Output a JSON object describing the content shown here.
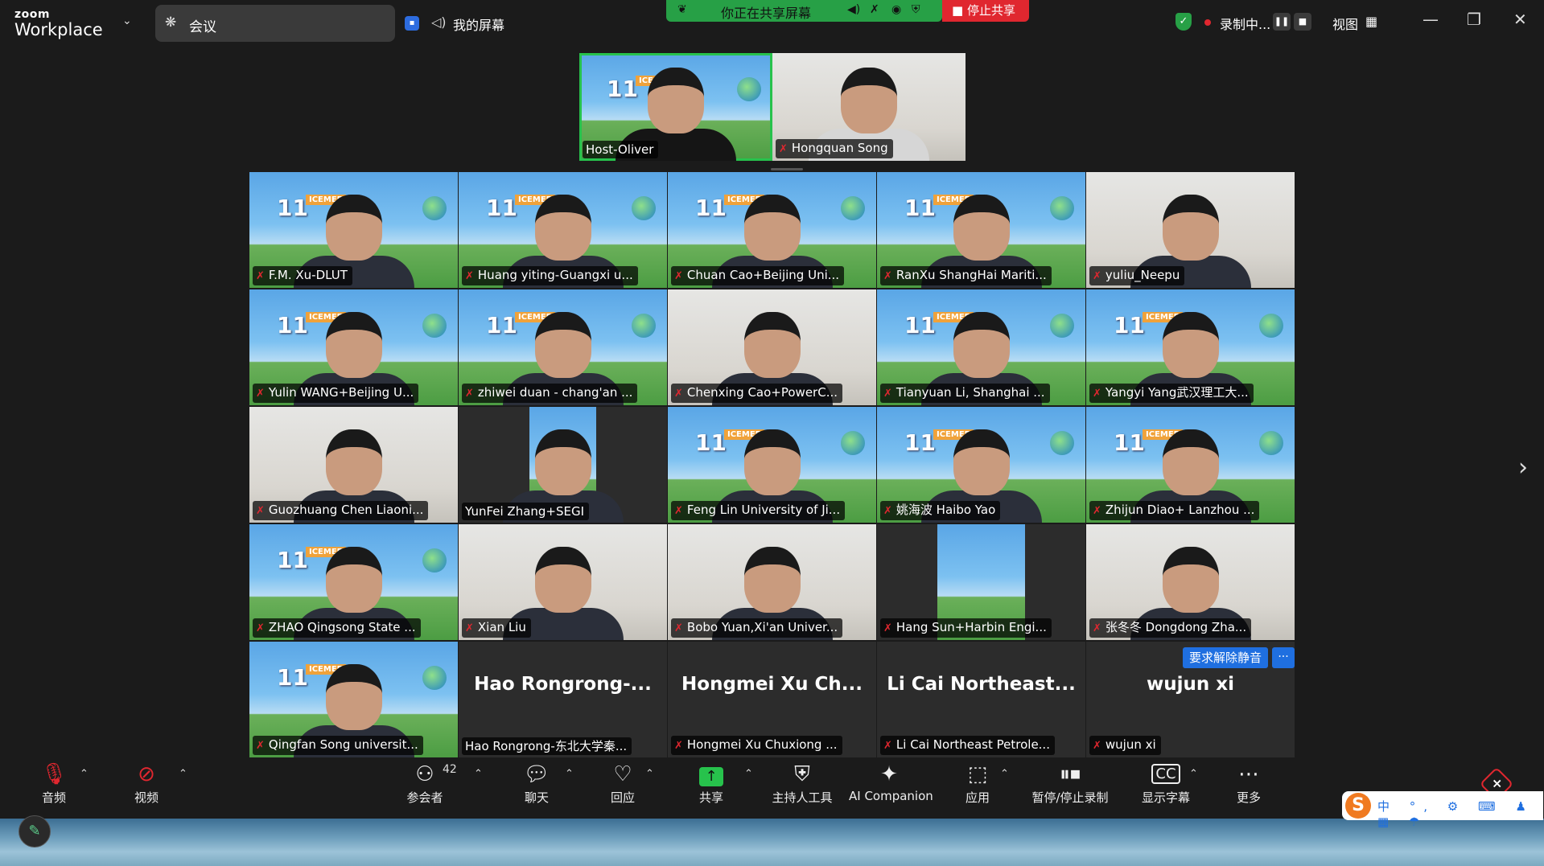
{
  "app": {
    "logo_top": "zoom",
    "logo_bottom": "Workplace"
  },
  "meeting": {
    "label": "会议"
  },
  "screen": {
    "label": "我的屏幕"
  },
  "share_bar": {
    "status": "你正在共享屏幕",
    "stop_label": "停止共享"
  },
  "recording": {
    "label": "录制中..."
  },
  "view": {
    "label": "视图"
  },
  "spotlight": [
    {
      "name": "Host-Oliver",
      "muted": false
    },
    {
      "name": "Hongquan Song",
      "muted": true
    }
  ],
  "grid": [
    {
      "name": "F.M. Xu-DLUT",
      "muted": true,
      "bg": "banner"
    },
    {
      "name": "Huang yiting-Guangxi u...",
      "muted": true,
      "bg": "banner"
    },
    {
      "name": "Chuan Cao+Beijing Uni...",
      "muted": true,
      "bg": "banner"
    },
    {
      "name": "RanXu ShangHai Mariti...",
      "muted": true,
      "bg": "banner"
    },
    {
      "name": "yuliu_Neepu",
      "muted": true,
      "bg": "room"
    },
    {
      "name": "Yulin WANG+Beijing U...",
      "muted": true,
      "bg": "banner"
    },
    {
      "name": "zhiwei duan - chang'an ...",
      "muted": true,
      "bg": "banner"
    },
    {
      "name": "Chenxing Cao+PowerC...",
      "muted": true,
      "bg": "room"
    },
    {
      "name": "Tianyuan Li, Shanghai ...",
      "muted": true,
      "bg": "banner"
    },
    {
      "name": "Yangyi Yang武汉理工大...",
      "muted": true,
      "bg": "banner"
    },
    {
      "name": "Guozhuang Chen Liaoni...",
      "muted": true,
      "bg": "room"
    },
    {
      "name": "YunFei Zhang+SEGI",
      "muted": false,
      "bg": "narrow"
    },
    {
      "name": "Feng Lin University of Ji...",
      "muted": true,
      "bg": "banner"
    },
    {
      "name": "姚海波  Haibo Yao",
      "muted": true,
      "bg": "banner"
    },
    {
      "name": "Zhijun Diao+ Lanzhou ...",
      "muted": true,
      "bg": "banner"
    },
    {
      "name": "ZHAO Qingsong  State ...",
      "muted": true,
      "bg": "banner"
    },
    {
      "name": "Xian Liu",
      "muted": true,
      "bg": "room"
    },
    {
      "name": "Bobo Yuan,Xi'an Univer...",
      "muted": true,
      "bg": "room"
    },
    {
      "name": "Hang Sun+Harbin Engi...",
      "muted": true,
      "bg": "poster"
    },
    {
      "name": "张冬冬  Dongdong Zha...",
      "muted": true,
      "bg": "room"
    },
    {
      "name": "Qingfan Song universit...",
      "muted": true,
      "bg": "banner"
    },
    {
      "name": "Hao Rongrong-东北大学秦...",
      "muted": false,
      "bg": "text",
      "big": "Hao Rongrong-..."
    },
    {
      "name": "Hongmei Xu Chuxiong ...",
      "muted": true,
      "bg": "text",
      "big": "Hongmei Xu Ch..."
    },
    {
      "name": "Li Cai Northeast Petrole...",
      "muted": true,
      "bg": "text",
      "big": "Li Cai Northeast..."
    },
    {
      "name": "wujun xi",
      "muted": true,
      "bg": "text",
      "big": "wujun xi"
    }
  ],
  "actions": {
    "request_unmute": "要求解除静音",
    "more": "···"
  },
  "toolbar": {
    "audio": "音频",
    "video": "视频",
    "participants": "参会者",
    "participants_count": "42",
    "chat": "聊天",
    "react": "回应",
    "share": "共享",
    "host_tools": "主持人工具",
    "ai_companion": "AI Companion",
    "apps": "应用",
    "pause_recording": "暂停/停止录制",
    "captions": "显示字幕",
    "more": "更多"
  },
  "ime": {
    "items": "中 °, ⚙ ⌨ ♟ ▦ ☂"
  }
}
